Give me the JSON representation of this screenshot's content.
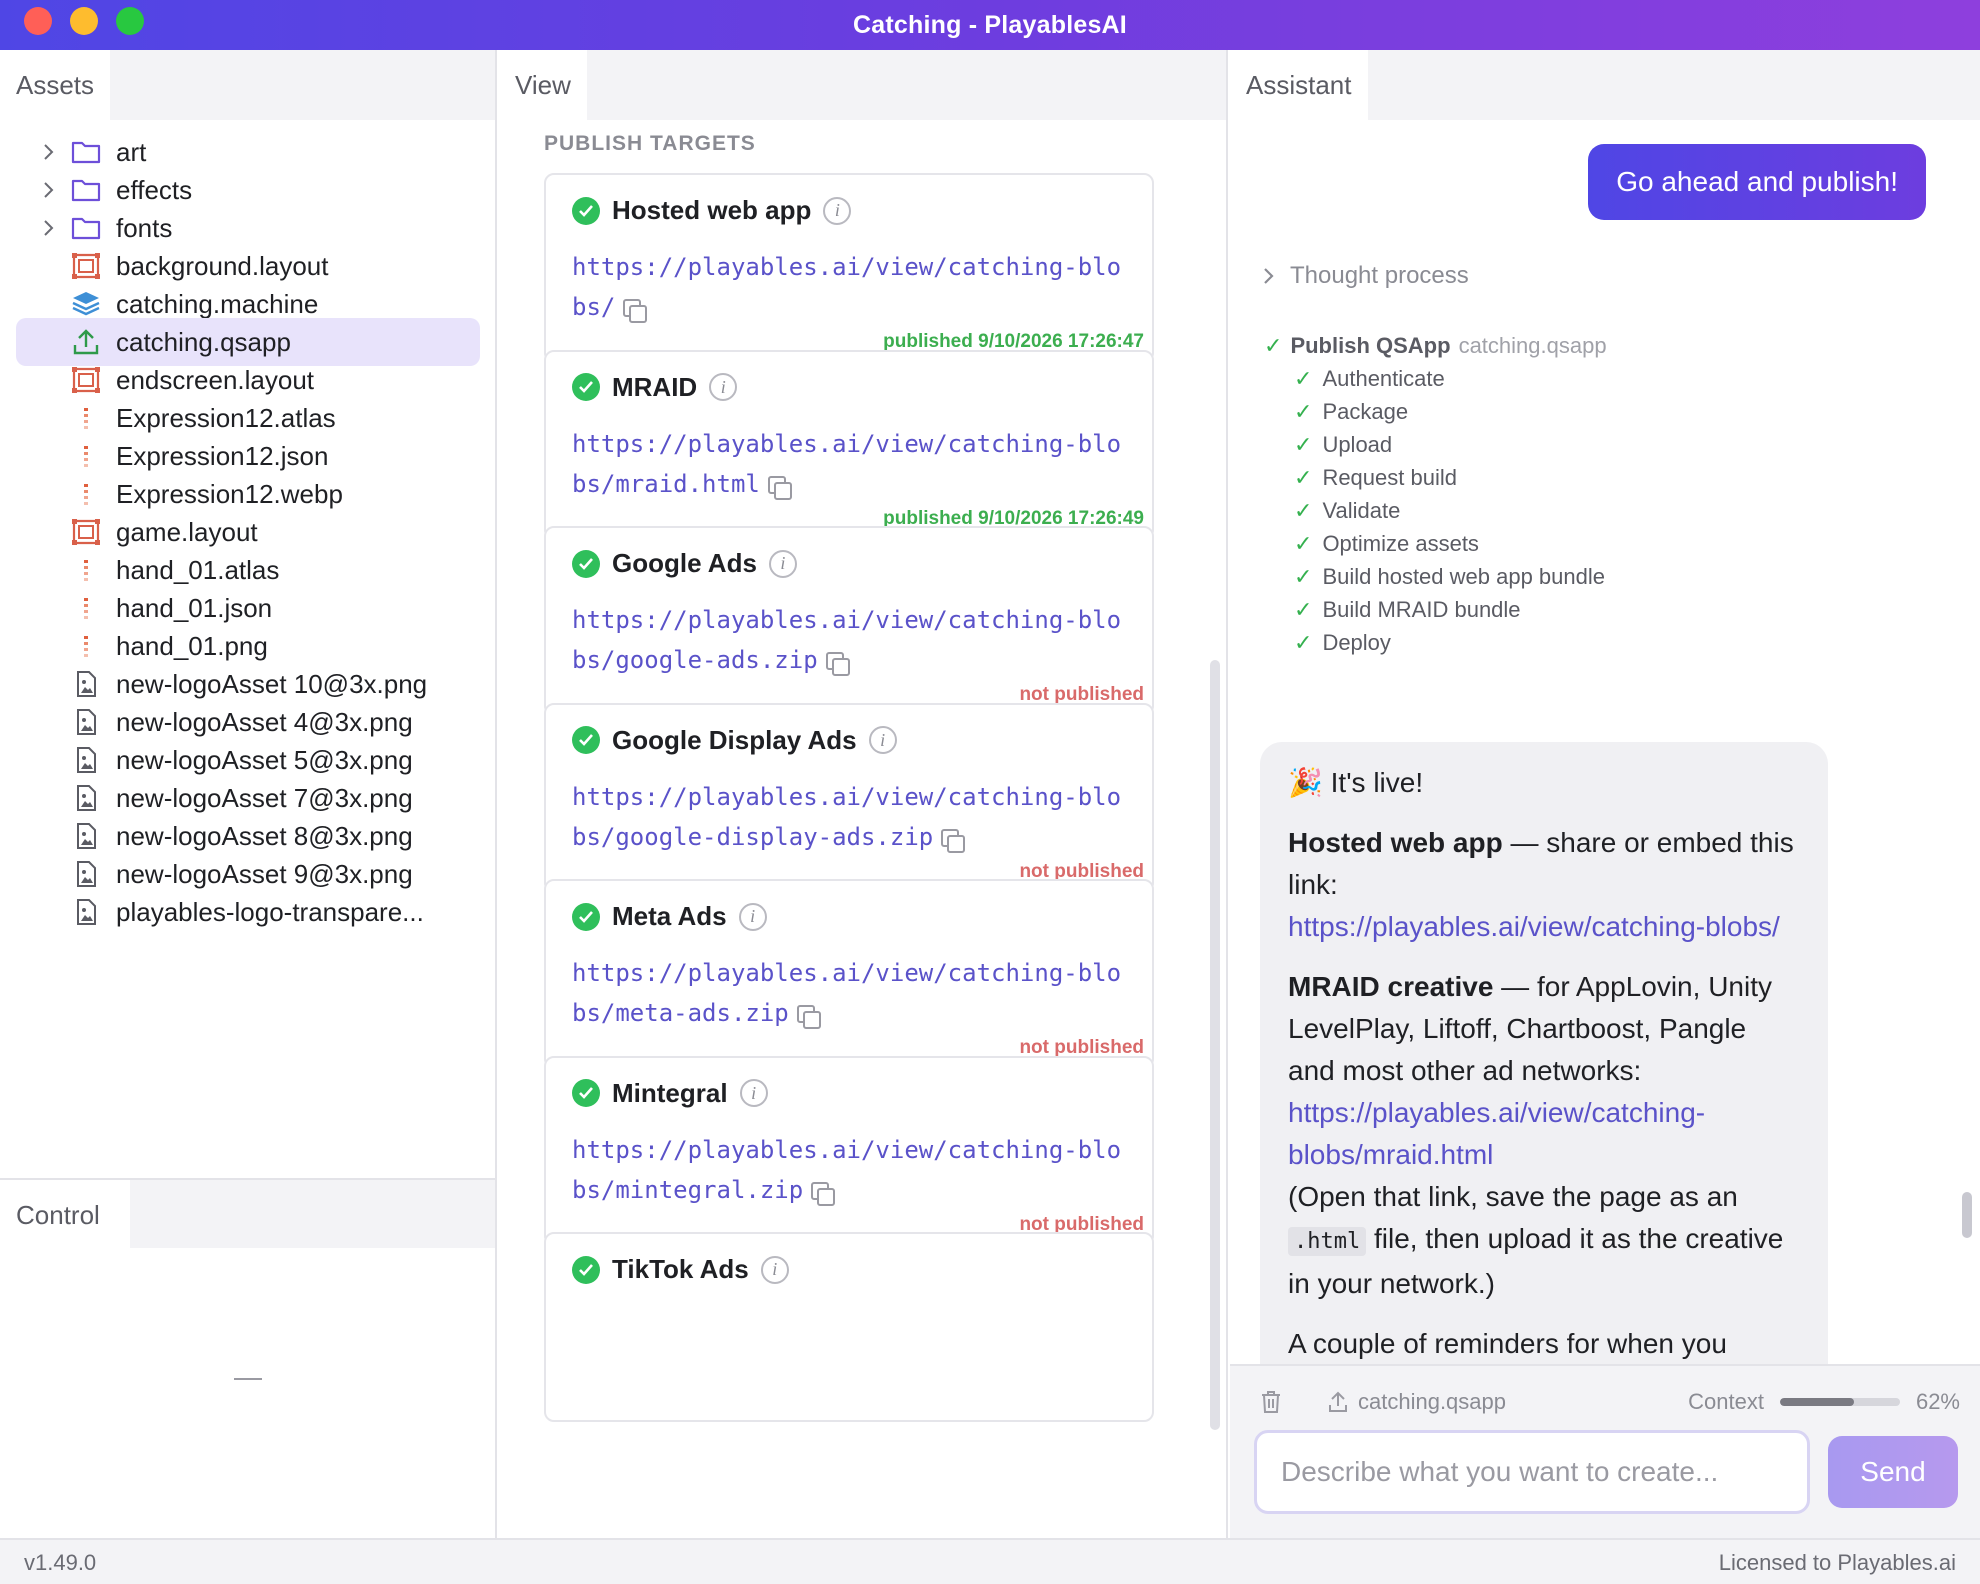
{
  "window": {
    "title": "Catching - PlayablesAI"
  },
  "assets": {
    "tab_label": "Assets",
    "items": [
      {
        "label": "art",
        "kind": "folder",
        "expandable": true
      },
      {
        "label": "effects",
        "kind": "folder",
        "expandable": true
      },
      {
        "label": "fonts",
        "kind": "folder",
        "expandable": true
      },
      {
        "label": "background.layout",
        "kind": "layout"
      },
      {
        "label": "catching.machine",
        "kind": "machine"
      },
      {
        "label": "catching.qsapp",
        "kind": "qsapp",
        "selected": true
      },
      {
        "label": "endscreen.layout",
        "kind": "layout"
      },
      {
        "label": "Expression12.atlas",
        "kind": "spine"
      },
      {
        "label": "Expression12.json",
        "kind": "spine"
      },
      {
        "label": "Expression12.webp",
        "kind": "spine"
      },
      {
        "label": "game.layout",
        "kind": "layout"
      },
      {
        "label": "hand_01.atlas",
        "kind": "spine"
      },
      {
        "label": "hand_01.json",
        "kind": "spine"
      },
      {
        "label": "hand_01.png",
        "kind": "spine"
      },
      {
        "label": "new-logoAsset 10@3x.png",
        "kind": "image"
      },
      {
        "label": "new-logoAsset 4@3x.png",
        "kind": "image"
      },
      {
        "label": "new-logoAsset 5@3x.png",
        "kind": "image"
      },
      {
        "label": "new-logoAsset 7@3x.png",
        "kind": "image"
      },
      {
        "label": "new-logoAsset 8@3x.png",
        "kind": "image"
      },
      {
        "label": "new-logoAsset 9@3x.png",
        "kind": "image"
      },
      {
        "label": "playables-logo-transpare...",
        "kind": "image"
      }
    ]
  },
  "control": {
    "tab_label": "Control"
  },
  "view": {
    "tab_label": "View",
    "section_label": "PUBLISH TARGETS",
    "targets": [
      {
        "name": "Hosted web app",
        "url": "https://playables.ai/view/catching-blobs/",
        "status": "published 9/10/2026 17:26:47",
        "published": true
      },
      {
        "name": "MRAID",
        "url": "https://playables.ai/view/catching-blobs/mraid.html",
        "status": "published 9/10/2026 17:26:49",
        "published": true
      },
      {
        "name": "Google Ads",
        "url": "https://playables.ai/view/catching-blobs/google-ads.zip",
        "status": "not published",
        "published": false
      },
      {
        "name": "Google Display Ads",
        "url": "https://playables.ai/view/catching-blobs/google-display-ads.zip",
        "status": "not published",
        "published": false
      },
      {
        "name": "Meta Ads",
        "url": "https://playables.ai/view/catching-blobs/meta-ads.zip",
        "status": "not published",
        "published": false
      },
      {
        "name": "Mintegral",
        "url": "https://playables.ai/view/catching-blobs/mintegral.zip",
        "status": "not published",
        "published": false
      },
      {
        "name": "TikTok Ads",
        "url": "",
        "status": "",
        "published": false
      }
    ]
  },
  "assistant": {
    "tab_label": "Assistant",
    "user_message": "Go ahead and publish!",
    "thought_label": "Thought process",
    "task": {
      "label": "Publish QSApp",
      "target": "catching.qsapp"
    },
    "steps": [
      "Authenticate",
      "Package",
      "Upload",
      "Request build",
      "Validate",
      "Optimize assets",
      "Build hosted web app bundle",
      "Build MRAID bundle",
      "Deploy"
    ],
    "reply": {
      "headline": "🎉 It's live!",
      "hosted_title": "Hosted web app",
      "hosted_text": " — share or embed this link:",
      "hosted_link": "https://playables.ai/view/catching-blobs/",
      "mraid_title": "MRAID creative",
      "mraid_text": " — for AppLovin, Unity LevelPlay, Liftoff, Chartboost, Pangle and most other ad networks:",
      "mraid_link": "https://playables.ai/view/catching-blobs/mraid.html",
      "note_before": "(Open that link, save the page as an ",
      "note_code": ".html",
      "note_after": " file, then upload it as the creative in your network.)",
      "reminder": "A couple of reminders for when you"
    },
    "footer": {
      "file": "catching.qsapp",
      "context_label": "Context",
      "context_value": "62%",
      "context_fraction": 0.62
    },
    "input_placeholder": "Describe what you want to create...",
    "send_label": "Send"
  },
  "statusbar": {
    "version": "v1.49.0",
    "license": "Licensed to Playables.ai"
  },
  "colors": {
    "accent": "#5b46e0",
    "published": "#3cae4f",
    "not_published": "#d96a6a",
    "link": "#5a52c9"
  }
}
